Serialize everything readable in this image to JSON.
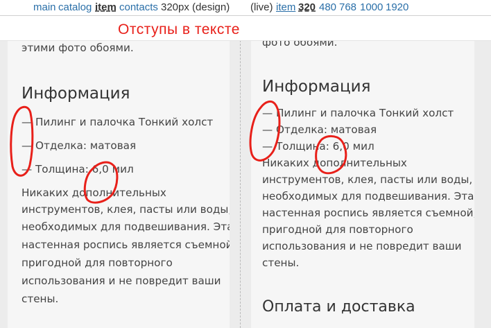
{
  "nav": {
    "main": "main",
    "catalog": "catalog",
    "item": "item",
    "contacts": "contacts",
    "width_design": "320px (design)",
    "live": "(live)",
    "live_item": "item",
    "size_320": "320",
    "size_480": "480",
    "size_768": "768",
    "size_1000": "1000",
    "size_1920": "1920"
  },
  "annotation_title": "Отступы в тексте",
  "left": {
    "top_fragment": "этими фото обоями.",
    "heading": "Информация",
    "list": [
      "—  Пилинг и палочка Тонкий холст",
      "—  Отделка: матовая",
      "—  Толщина: 6,0 мил"
    ],
    "paragraph": [
      "Никаких дополнительных",
      "инструментов, клея, пасты или воды,",
      "необходимых для подвешивания. Эта",
      "настенная роспись является съемной,",
      "пригодной для повторного",
      "использования и не повредит ваши",
      "стены."
    ]
  },
  "right": {
    "top_fragment": "фото обоями.",
    "heading": "Информация",
    "list": [
      "— Пилинг и палочка Тонкий холст",
      "— Отделка: матовая",
      "— Толщина: 6,0 мил"
    ],
    "paragraph": [
      "Никаких дополнительных",
      "инструментов, клея, пасты или воды,",
      "необходимых для подвешивания. Эта",
      "настенная роспись является съемной,",
      "пригодной для повторного",
      "использования и не повредит ваши",
      "стены."
    ],
    "heading2": "Оплата и доставка"
  },
  "colors": {
    "link": "#2a6fa8",
    "annotation": "#e8201a",
    "panel_bg": "#f6f6f6",
    "page_bg": "#ececec"
  }
}
